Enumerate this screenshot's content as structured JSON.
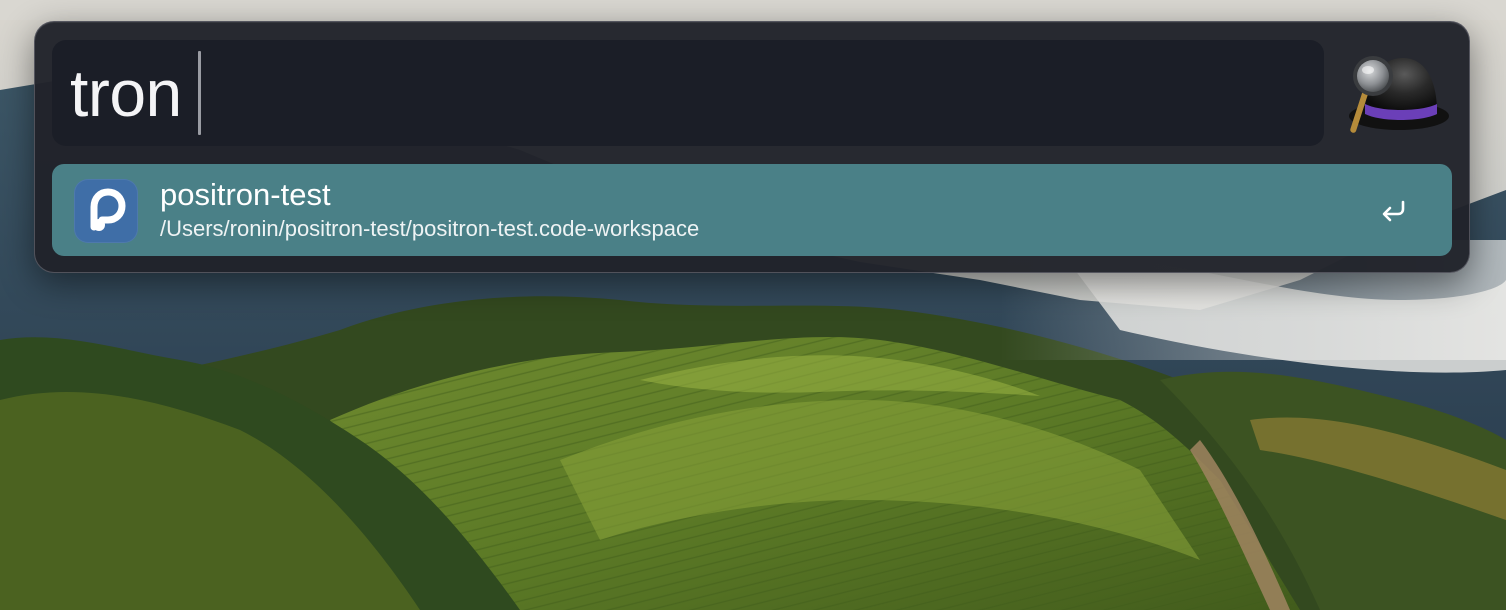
{
  "search": {
    "query": "tron"
  },
  "app": {
    "logo_icon": "alfred-hat-magnifier-icon"
  },
  "results": [
    {
      "title": "positron-test",
      "subtitle": "/Users/ronin/positron-test/positron-test.code-workspace",
      "icon": "positron-app-icon",
      "action_icon": "return-key-icon"
    }
  ],
  "colors": {
    "selected_row": "#4a8087",
    "window_bg": "#21232a",
    "search_field_bg": "#1b1e27",
    "app_icon_bg": "#3f6ea7",
    "hat_band": "#6b3fb8"
  }
}
